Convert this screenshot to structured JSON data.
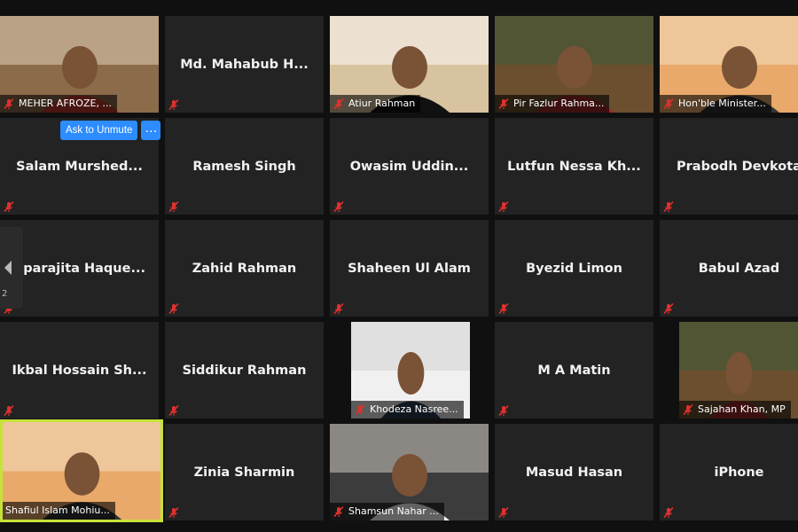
{
  "meeting": {
    "participants": [
      {
        "name": "MEHER AFROZE, ...",
        "video": true
      },
      {
        "name": "Md. Mahabub H...",
        "video": false
      },
      {
        "name": "Atiur Rahman",
        "video": true
      },
      {
        "name": "Pir Fazlur Rahma...",
        "video": true
      },
      {
        "name": "Hon'ble Minister...",
        "video": true
      },
      {
        "name": "Salam  Murshed...",
        "video": false
      },
      {
        "name": "Ramesh Singh",
        "video": false
      },
      {
        "name": "Owasim  Uddin...",
        "video": false
      },
      {
        "name": "Lutfun Nessa Kh...",
        "video": false
      },
      {
        "name": "Prabodh Devkota",
        "video": false
      },
      {
        "name": "Aparajita  Haque...",
        "video": false
      },
      {
        "name": "Zahid Rahman",
        "video": false
      },
      {
        "name": "Shaheen Ul Alam",
        "video": false
      },
      {
        "name": "Byezid Limon",
        "video": false
      },
      {
        "name": "Babul Azad",
        "video": false
      },
      {
        "name": "Ikbal  Hossain  Sh...",
        "video": false
      },
      {
        "name": "Siddikur Rahman",
        "video": false
      },
      {
        "name": "Khodeza Nasree...",
        "video": true
      },
      {
        "name": "M A Matin",
        "video": false
      },
      {
        "name": "Sajahan Khan, MP",
        "video": true
      },
      {
        "name": "Shafiul Islam Mohiu...",
        "video": true,
        "active_speaker": true
      },
      {
        "name": "Zinia Sharmin",
        "video": false
      },
      {
        "name": "Shamsun Nahar ...",
        "video": true
      },
      {
        "name": "Masud Hasan",
        "video": false
      },
      {
        "name": "iPhone",
        "video": false
      }
    ],
    "hover_actions": {
      "ask_to_unmute_label": "Ask to Unmute",
      "more_label": "…"
    },
    "page_indicator": "2",
    "colors": {
      "tile_bg": "#232323",
      "active_border": "#c6e23a",
      "accent_button": "#2d8cff",
      "mute_icon": "#e0312e"
    },
    "icons": {
      "mute": "muted-microphone-icon",
      "nav": "left-arrow-icon"
    }
  }
}
